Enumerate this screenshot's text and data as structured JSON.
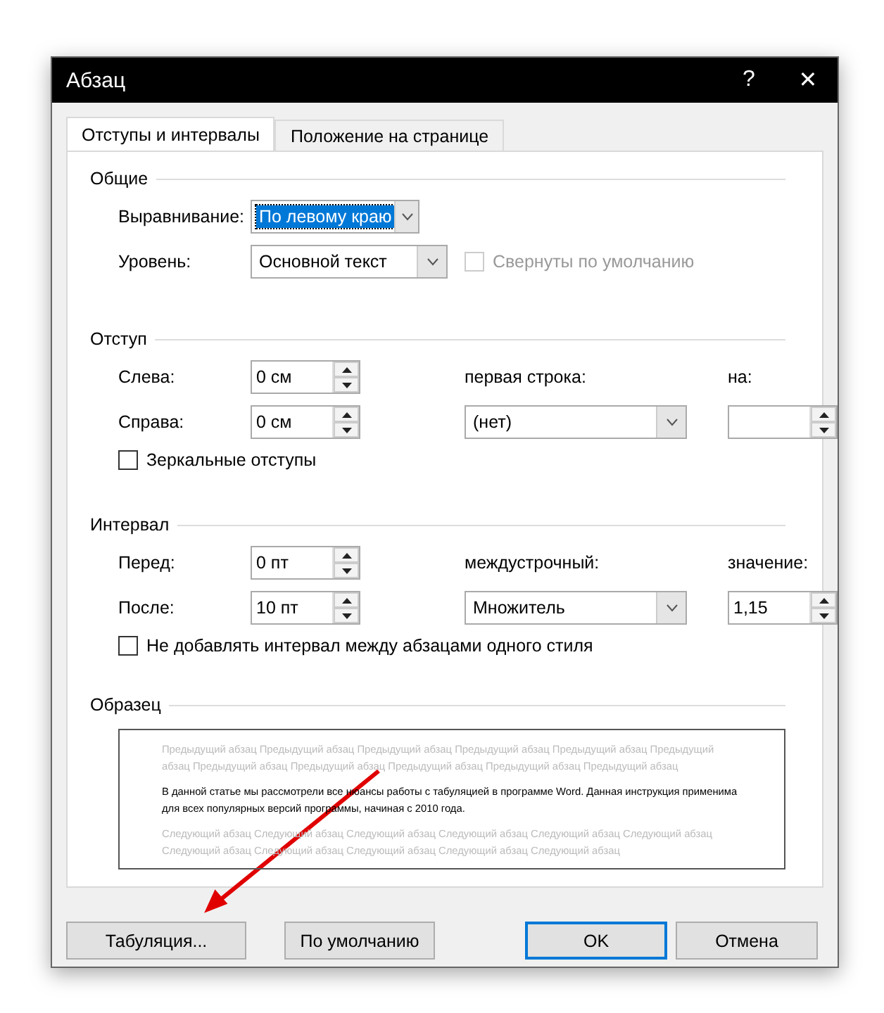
{
  "window": {
    "title": "Абзац",
    "help": "?",
    "close": "✕"
  },
  "tabs": [
    {
      "label": "Отступы и интервалы",
      "selected": true
    },
    {
      "label": "Положение на странице",
      "selected": false
    }
  ],
  "general": {
    "title": "Общие",
    "alignment": {
      "label": "Выравнивание:",
      "value": "По левому краю",
      "focused": true
    },
    "level": {
      "label": "Уровень:",
      "value": "Основной текст",
      "focused": false
    },
    "collapsed": {
      "label": "Свернуты по умолчанию",
      "checked": false,
      "disabled": true
    }
  },
  "indent": {
    "title": "Отступ",
    "left": {
      "label": "Слева:",
      "value": "0 см"
    },
    "right": {
      "label": "Справа:",
      "value": "0 см"
    },
    "first_line": {
      "label": "первая строка:",
      "value": "(нет)"
    },
    "by": {
      "label": "на:"
    },
    "mirror": {
      "label": "Зеркальные отступы",
      "checked": false,
      "disabled": false
    }
  },
  "spacing": {
    "title": "Интервал",
    "before": {
      "label": "Перед:",
      "value": "0 пт"
    },
    "after": {
      "label": "После:",
      "value": "10 пт"
    },
    "line_spacing": {
      "label": "междустрочный:",
      "value": "Множитель"
    },
    "at": {
      "label": "значение:",
      "value": "1,15"
    },
    "no_space": {
      "label": "Не добавлять интервал между абзацами одного стиля",
      "checked": false,
      "disabled": false
    }
  },
  "preview": {
    "title": "Образец",
    "previous": "Предыдущий абзац Предыдущий абзац Предыдущий абзац Предыдущий абзац Предыдущий абзац Предыдущий абзац Предыдущий абзац Предыдущий абзац Предыдущий абзац Предыдущий абзац Предыдущий абзац",
    "current": "В данной статье мы рассмотрели все нюансы работы с табуляцией в программе Word. Данная инструкция применима для всех популярных версий программы, начиная с 2010 года.",
    "next": "Следующий абзац Следующий абзац Следующий абзац Следующий абзац Следующий абзац Следующий абзац Следующий абзац Следующий абзац Следующий абзац Следующий абзац Следующий абзац"
  },
  "buttons": [
    {
      "label": "Табуляция...",
      "default": false
    },
    {
      "label": "По умолчанию",
      "default": false
    },
    {
      "label": "OK",
      "default": true
    },
    {
      "label": "Отмена",
      "default": false
    }
  ]
}
